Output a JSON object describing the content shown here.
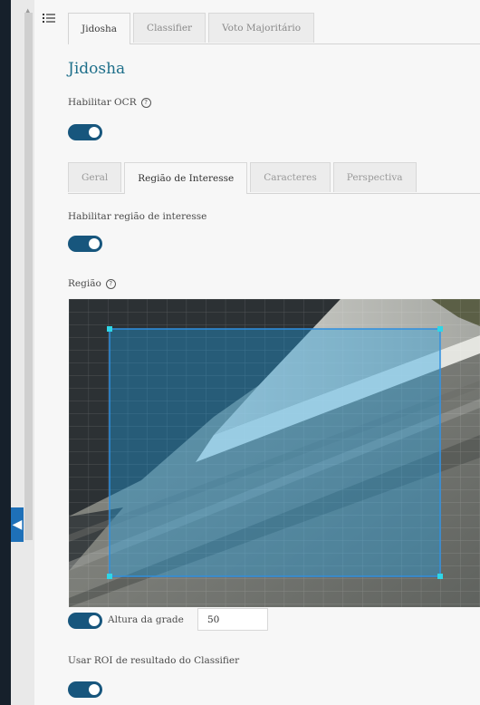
{
  "top_tabs": [
    "Jidosha",
    "Classifier",
    "Voto Majoritário"
  ],
  "section_title": "Jidosha",
  "ocr": {
    "label": "Habilitar OCR",
    "enabled": true
  },
  "sub_tabs": [
    "Geral",
    "Região de Interesse",
    "Caracteres",
    "Perspectiva"
  ],
  "roi": {
    "label": "Habilitar região de interesse",
    "enabled": true
  },
  "region": {
    "label": "Região"
  },
  "grid": {
    "label": "Altura da grade",
    "value": "50",
    "enabled": true
  },
  "classifier_roi": {
    "label": "Usar ROI de resultado do Classifier",
    "enabled": true
  },
  "colors": {
    "accent": "#17567d",
    "title": "#1e6f8a",
    "selection": "#1fa3e8",
    "handle": "#2fd6e6"
  },
  "icons": [
    "menu-icon",
    "help-icon",
    "chevron-left-icon"
  ]
}
